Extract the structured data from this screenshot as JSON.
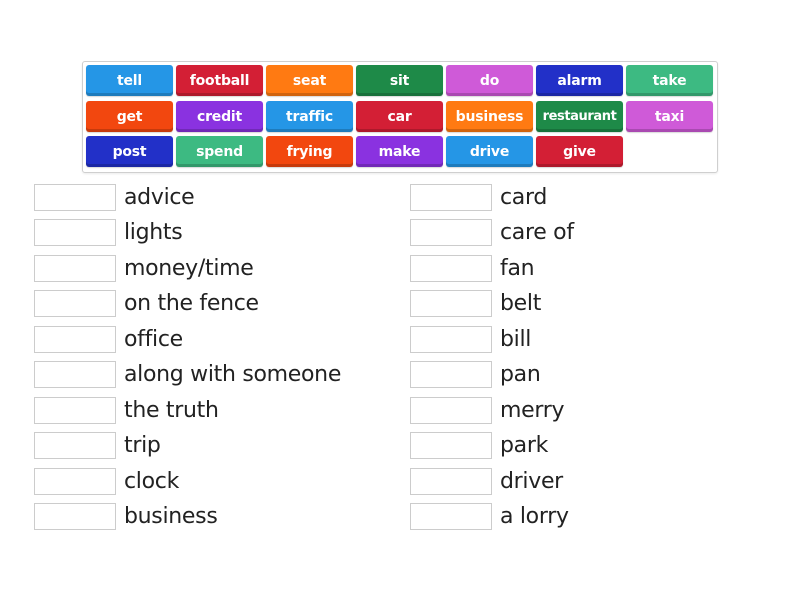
{
  "word_bank": [
    {
      "word": "tell",
      "color": "#2596e6"
    },
    {
      "word": "football",
      "color": "#d31f35"
    },
    {
      "word": "seat",
      "color": "#ff7a12"
    },
    {
      "word": "sit",
      "color": "#1e8a48"
    },
    {
      "word": "do",
      "color": "#cf5ad8"
    },
    {
      "word": "alarm",
      "color": "#2230c8"
    },
    {
      "word": "take",
      "color": "#3dba82"
    },
    {
      "word": "get",
      "color": "#f2470f"
    },
    {
      "word": "credit",
      "color": "#8a32e0"
    },
    {
      "word": "traffic",
      "color": "#2596e6"
    },
    {
      "word": "car",
      "color": "#d31f35"
    },
    {
      "word": "business",
      "color": "#ff7a12"
    },
    {
      "word": "restaurant",
      "color": "#1e8a48"
    },
    {
      "word": "taxi",
      "color": "#cf5ad8"
    },
    {
      "word": "post",
      "color": "#2230c8"
    },
    {
      "word": "spend",
      "color": "#3dba82"
    },
    {
      "word": "frying",
      "color": "#f2470f"
    },
    {
      "word": "make",
      "color": "#8a32e0"
    },
    {
      "word": "drive",
      "color": "#2596e6"
    },
    {
      "word": "give",
      "color": "#d31f35"
    }
  ],
  "left_column": [
    {
      "answer": "",
      "phrase": "advice"
    },
    {
      "answer": "",
      "phrase": "lights"
    },
    {
      "answer": "",
      "phrase": "money/time"
    },
    {
      "answer": "",
      "phrase": "on the fence"
    },
    {
      "answer": "",
      "phrase": "office"
    },
    {
      "answer": "",
      "phrase": "along with someone"
    },
    {
      "answer": "",
      "phrase": "the truth"
    },
    {
      "answer": "",
      "phrase": "trip"
    },
    {
      "answer": "",
      "phrase": "clock"
    },
    {
      "answer": "",
      "phrase": "business"
    }
  ],
  "right_column": [
    {
      "answer": "",
      "phrase": "card"
    },
    {
      "answer": "",
      "phrase": "care of"
    },
    {
      "answer": "",
      "phrase": "fan"
    },
    {
      "answer": "",
      "phrase": "belt"
    },
    {
      "answer": "",
      "phrase": "bill"
    },
    {
      "answer": "",
      "phrase": "pan"
    },
    {
      "answer": "",
      "phrase": "merry"
    },
    {
      "answer": "",
      "phrase": "park"
    },
    {
      "answer": "",
      "phrase": "driver"
    },
    {
      "answer": "",
      "phrase": "a lorry"
    }
  ]
}
